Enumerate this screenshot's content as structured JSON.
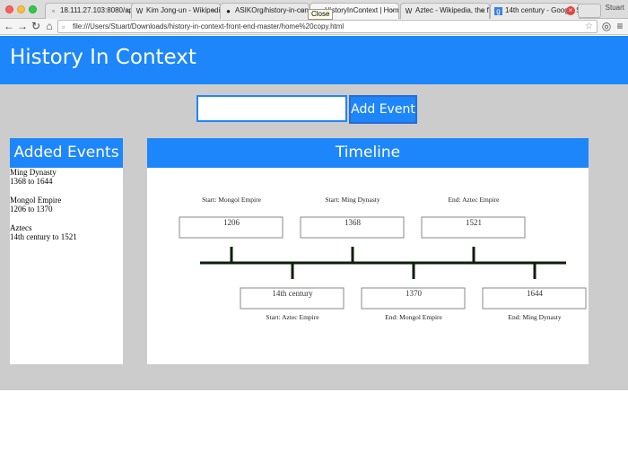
{
  "browser": {
    "tabs": [
      {
        "label": "18.111.27.103:8080/api/",
        "icon": "page-icon"
      },
      {
        "label": "Kim Jong-un - Wikipedia",
        "icon": "wikipedia-icon"
      },
      {
        "label": "ASIKOrg/history-in-conte",
        "icon": "github-icon"
      },
      {
        "label": "HistoryInContext | Home",
        "icon": "page-icon",
        "active": true
      },
      {
        "label": "Aztec - Wikipedia, the fre",
        "icon": "wikipedia-icon"
      },
      {
        "label": "14th century - Google Se",
        "icon": "google-icon"
      }
    ],
    "tooltip": "Close",
    "profile": "Stuart",
    "url": "file:///Users/Stuart/Downloads/history-in-context-front-end-master/home%20copy.html"
  },
  "app": {
    "title": "History In Context",
    "input_value": "",
    "add_button": "Add Event",
    "added_events_title": "Added Events",
    "timeline_title": "Timeline"
  },
  "added_events": [
    {
      "name": "Ming Dynasty",
      "range": "1368 to 1644"
    },
    {
      "name": "Mongol Empire",
      "range": "1206 to 1370"
    },
    {
      "name": "Aztecs",
      "range": "14th century to 1521"
    }
  ],
  "timeline": {
    "above": [
      {
        "caption": "Start: Mongol Empire",
        "value": "1206"
      },
      {
        "caption": "Start: Ming Dynasty",
        "value": "1368"
      },
      {
        "caption": "End: Aztec Empire",
        "value": "1521"
      }
    ],
    "below": [
      {
        "caption": "Start: Aztec Empire",
        "value": "14th century"
      },
      {
        "caption": "End: Mongol Empire",
        "value": "1370"
      },
      {
        "caption": "End: Ming Dynasty",
        "value": "1644"
      }
    ],
    "colors": {
      "axis": "#0d1f0d"
    }
  },
  "colors": {
    "brand": "#1e86fb",
    "background": "#cccccc"
  }
}
